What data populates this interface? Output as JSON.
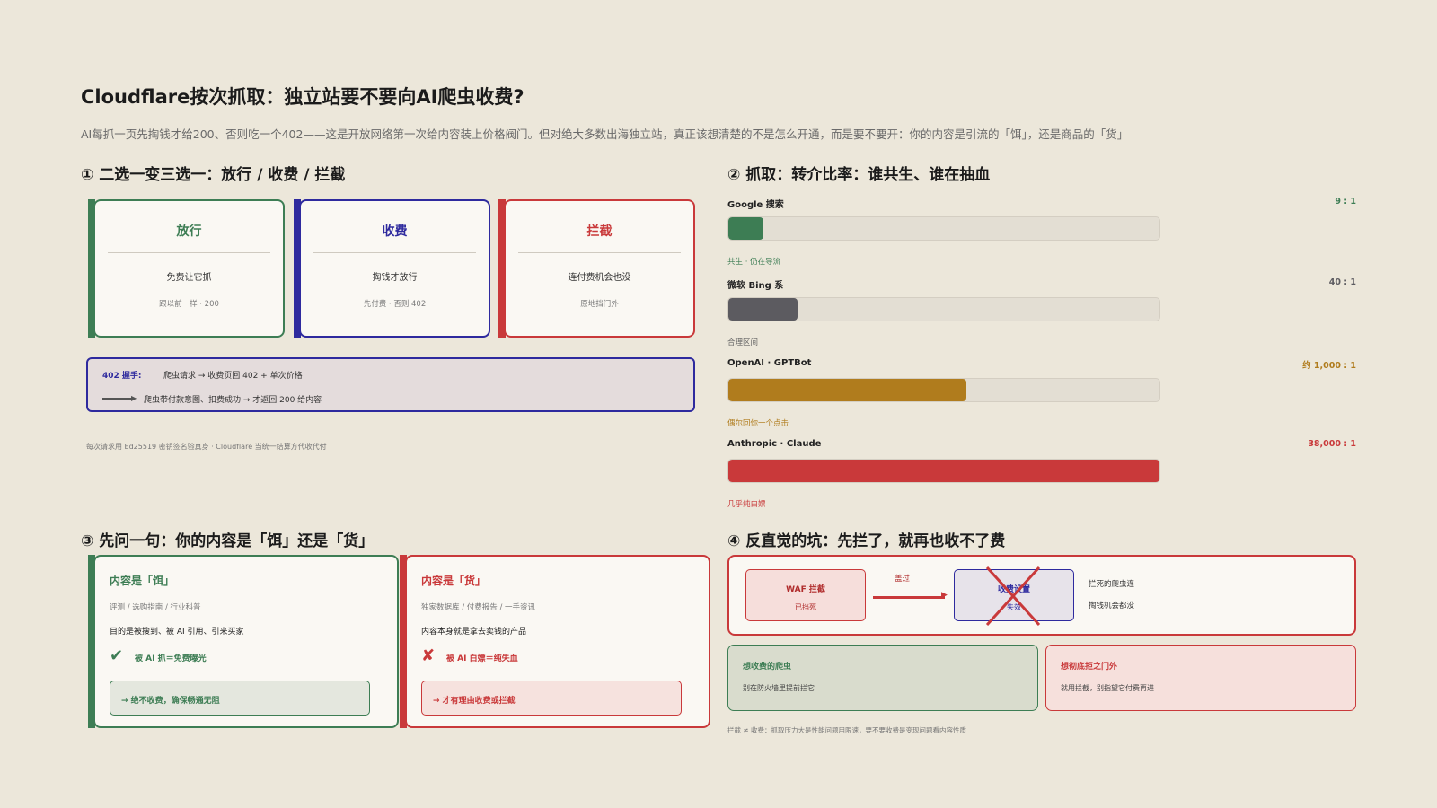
{
  "page": {
    "title": "Cloudflare按次抓取：独立站要不要向AI爬虫收费?",
    "subtitle": "AI每抓一页先掏钱才给200、否则吃一个402——这是开放网络第一次给内容装上价格阀门。但对绝大多数出海独立站，真正该想清楚的不是怎么开通，而是要不要开：你的内容是引流的「饵」，还是商品的「货」"
  },
  "colors": {
    "green": "#3d7d54",
    "blue": "#2e2a9e",
    "red": "#c9393a",
    "gray": "#5c5b60",
    "gold": "#b07c1d"
  },
  "section1": {
    "title": "① 二选一变三选一：放行 / 收费 / 拦截",
    "options": [
      {
        "name": "放行",
        "desc": "免费让它抓",
        "note": "跟以前一样 · 200"
      },
      {
        "name": "收费",
        "desc": "掏钱才放行",
        "note": "先付费 · 否则 402"
      },
      {
        "name": "拦截",
        "desc": "连付费机会也没",
        "note": "原地挡门外"
      }
    ],
    "handshake": {
      "label": "402 握手:",
      "line1": "爬虫请求 → 收费页回 402 + 单次价格",
      "line2": "爬虫带付款意图、扣费成功 → 才返回 200 给内容"
    },
    "footnote": "每次请求用 Ed25519 密钥签名验真身 · Cloudflare 当统一结算方代收代付"
  },
  "section2": {
    "title": "② 抓取：转介比率：谁共生、谁在抽血",
    "rows": [
      {
        "name": "Google 搜索",
        "ratio": "9 : 1",
        "note": "共生 · 仍在导流",
        "level": 0.08
      },
      {
        "name": "微软 Bing 系",
        "ratio": "40 : 1",
        "note": "合理区间",
        "level": 0.16
      },
      {
        "name": "OpenAI · GPTBot",
        "ratio": "约 1,000 : 1",
        "note": "偶尔回你一个点击",
        "level": 0.55
      },
      {
        "name": "Anthropic · Claude",
        "ratio": "38,000 : 1",
        "note": "几乎纯白嫖",
        "level": 1.0
      }
    ]
  },
  "section3": {
    "title": "③ 先问一句：你的内容是「饵」还是「货」",
    "bait": {
      "heading": "内容是「饵」",
      "sub": "评测 / 选购指南 / 行业科普",
      "desc": "目的是被搜到、被 AI 引用、引来买家",
      "mark": "✔",
      "result": "被 AI 抓＝免费曝光",
      "verdict": "→ 绝不收费，确保畅通无阻"
    },
    "goods": {
      "heading": "内容是「货」",
      "sub": "独家数据库 / 付费报告 / 一手资讯",
      "desc": "内容本身就是拿去卖钱的产品",
      "mark": "✘",
      "result": "被 AI 白嫖＝纯失血",
      "verdict": "→ 才有理由收费或拦截"
    }
  },
  "section4": {
    "title": "④ 反直觉的坑：先拦了，就再也收不了费",
    "waf": {
      "title": "WAF 拦截",
      "sub": "已挡死"
    },
    "cover": "盖过",
    "charge": {
      "title": "收费设置",
      "sub": "失效"
    },
    "result1": "拦死的爬虫连",
    "result2": "掏钱机会都没",
    "left": {
      "heading": "想收费的爬虫",
      "desc": "别在防火墙里提前拦它"
    },
    "right": {
      "heading": "想彻底拒之门外",
      "desc": "就用拦截，别指望它付费再进"
    },
    "footnote": "拦截 ≠ 收费：抓取压力大是性能问题用限速，要不要收费是变现问题看内容性质"
  }
}
